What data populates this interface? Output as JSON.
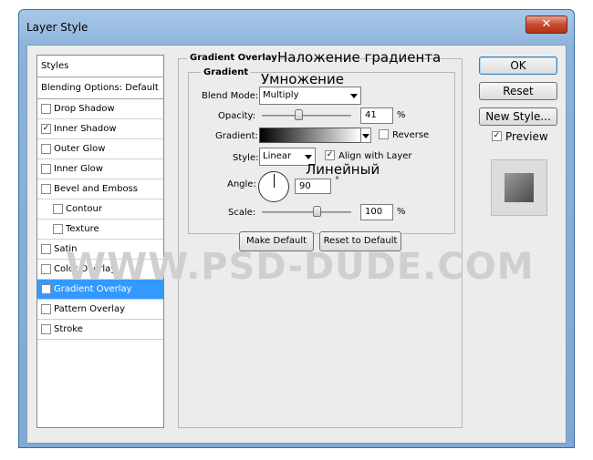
{
  "window": {
    "title": "Layer Style",
    "close_glyph": "✕"
  },
  "styles_list": {
    "header": "Styles",
    "blending": "Blending Options: Default",
    "items": [
      {
        "label": "Drop Shadow",
        "checked": false,
        "indent": false
      },
      {
        "label": "Inner Shadow",
        "checked": true,
        "indent": false
      },
      {
        "label": "Outer Glow",
        "checked": false,
        "indent": false
      },
      {
        "label": "Inner Glow",
        "checked": false,
        "indent": false
      },
      {
        "label": "Bevel and Emboss",
        "checked": false,
        "indent": false
      },
      {
        "label": "Contour",
        "checked": false,
        "indent": true
      },
      {
        "label": "Texture",
        "checked": false,
        "indent": true
      },
      {
        "label": "Satin",
        "checked": false,
        "indent": false
      },
      {
        "label": "Color Overlay",
        "checked": false,
        "indent": false
      },
      {
        "label": "Gradient Overlay",
        "checked": true,
        "indent": false,
        "selected": true
      },
      {
        "label": "Pattern Overlay",
        "checked": false,
        "indent": false
      },
      {
        "label": "Stroke",
        "checked": false,
        "indent": false
      }
    ]
  },
  "panel": {
    "title": "Gradient Overlay",
    "title_ru": "Наложение градиента",
    "subgroup_title": "Gradient",
    "blend_ru": "Умножение",
    "blend_mode_label": "Blend Mode:",
    "blend_mode_value": "Multiply",
    "opacity_label": "Opacity:",
    "opacity_value": "41",
    "opacity_unit": "%",
    "opacity_fraction": 0.41,
    "gradient_label": "Gradient:",
    "reverse_label": "Reverse",
    "style_label": "Style:",
    "style_value": "Linear",
    "style_ru": "Линейный",
    "align_label": "Align with Layer",
    "angle_label": "Angle:",
    "angle_value": "90",
    "angle_unit": "°",
    "scale_label": "Scale:",
    "scale_value": "100",
    "scale_unit": "%",
    "make_default": "Make Default",
    "reset_default": "Reset to Default"
  },
  "buttons": {
    "ok": "OK",
    "reset": "Reset",
    "new_style": "New Style...",
    "preview_label": "Preview"
  },
  "watermark": "WWW.PSD-DUDE.COM",
  "colors": {
    "accent_selected": "#3399ff",
    "title_bar": "#8db3dc"
  }
}
